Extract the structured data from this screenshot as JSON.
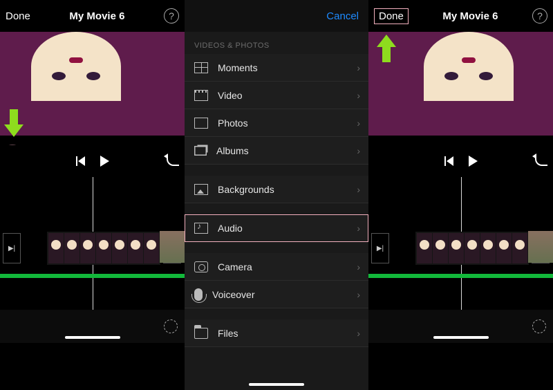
{
  "panel1": {
    "done": "Done",
    "title": "My Movie 6",
    "help": "?",
    "add": "+"
  },
  "panel2": {
    "cancel": "Cancel",
    "section": "VIDEOS & PHOTOS",
    "rows": {
      "moments": "Moments",
      "video": "Video",
      "photos": "Photos",
      "albums": "Albums",
      "backgrounds": "Backgrounds",
      "audio": "Audio",
      "camera": "Camera",
      "voiceover": "Voiceover",
      "files": "Files"
    }
  },
  "panel3": {
    "done": "Done",
    "title": "My Movie 6",
    "help": "?",
    "add": "+"
  }
}
